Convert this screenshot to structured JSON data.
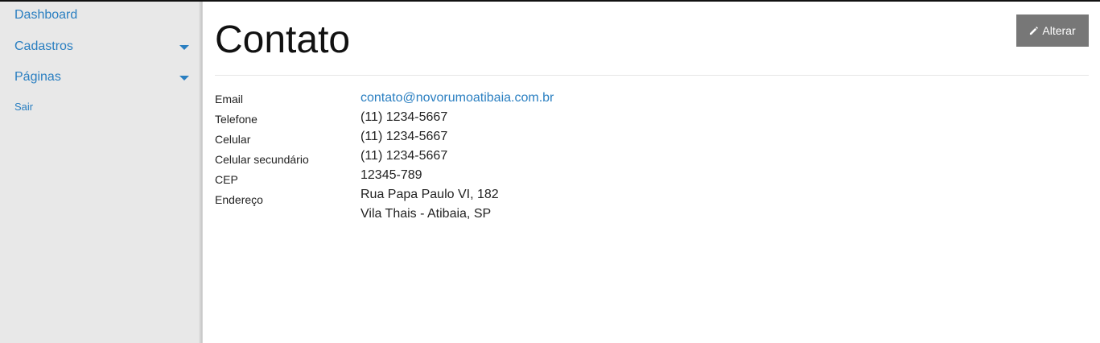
{
  "sidebar": {
    "items": [
      {
        "label": "Dashboard"
      },
      {
        "label": "Cadastros"
      },
      {
        "label": "Páginas"
      },
      {
        "label": "Sair"
      }
    ]
  },
  "main": {
    "title": "Contato",
    "edit_button": {
      "label": "Alterar",
      "icon": "pencil-icon"
    },
    "info": {
      "email": {
        "label": "Email",
        "value": "contato@novorumoatibaia.com.br"
      },
      "telefone": {
        "label": "Telefone",
        "value": "(11) 1234-5667"
      },
      "celular": {
        "label": "Celular",
        "value": "(11) 1234-5667"
      },
      "celular_secundario": {
        "label": "Celular secundário",
        "value": "(11) 1234-5667"
      },
      "cep": {
        "label": "CEP",
        "value": "12345-789"
      },
      "endereco": {
        "label": "Endereço",
        "line1": "Rua Papa Paulo VI, 182",
        "line2": "Vila Thais - Atibaia, SP"
      }
    }
  },
  "colors": {
    "sidebar_bg": "#e8e8e8",
    "link": "#2a7fc1",
    "button_bg": "#777777"
  }
}
